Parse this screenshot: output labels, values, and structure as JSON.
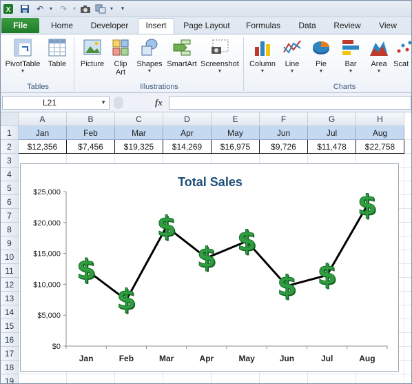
{
  "qat": {
    "icons": [
      "excel-logo-icon",
      "save-icon",
      "undo-icon",
      "redo-icon",
      "camera-icon",
      "shapes-icon",
      "customize-icon"
    ]
  },
  "tabs": {
    "file": "File",
    "items": [
      "Home",
      "Developer",
      "Insert",
      "Page Layout",
      "Formulas",
      "Data",
      "Review",
      "View"
    ],
    "active": "Insert"
  },
  "ribbon": {
    "tables": {
      "label": "Tables",
      "pivot": "PivotTable",
      "table": "Table"
    },
    "illustrations": {
      "label": "Illustrations",
      "picture": "Picture",
      "clipart_1": "Clip",
      "clipart_2": "Art",
      "shapes": "Shapes",
      "smartart": "SmartArt",
      "screenshot": "Screenshot"
    },
    "charts": {
      "label": "Charts",
      "column": "Column",
      "line": "Line",
      "pie": "Pie",
      "bar": "Bar",
      "area": "Area",
      "scatter": "Scat"
    }
  },
  "formula_bar": {
    "name_box": "L21",
    "fx": "fx",
    "value": ""
  },
  "grid": {
    "columns": [
      "A",
      "B",
      "C",
      "D",
      "E",
      "F",
      "G",
      "H"
    ],
    "rows": [
      "1",
      "2",
      "3",
      "4",
      "5",
      "6",
      "7",
      "8",
      "9",
      "10",
      "11",
      "12",
      "13",
      "14",
      "15",
      "16",
      "17",
      "18",
      "19"
    ],
    "row1": [
      "Jan",
      "Feb",
      "Mar",
      "Apr",
      "May",
      "Jun",
      "Jul",
      "Aug"
    ],
    "row2": [
      "$12,356",
      "$7,456",
      "$19,325",
      "$14,269",
      "$16,975",
      "$9,726",
      "$11,478",
      "$22,758"
    ]
  },
  "chart_data": {
    "type": "line",
    "title": "Total Sales",
    "categories": [
      "Jan",
      "Feb",
      "Mar",
      "Apr",
      "May",
      "Jun",
      "Jul",
      "Aug"
    ],
    "series": [
      {
        "values": [
          12356,
          7456,
          19325,
          14269,
          16975,
          9726,
          11478,
          22758
        ]
      }
    ],
    "y_ticks": [
      "$0",
      "$5,000",
      "$10,000",
      "$15,000",
      "$20,000",
      "$25,000"
    ],
    "ylim": [
      0,
      25000
    ],
    "marker": "$",
    "colors": {
      "title": "#1f4e79",
      "line": "#000000",
      "marker": "#2e9e3f"
    },
    "grid": false,
    "legend": "none"
  }
}
